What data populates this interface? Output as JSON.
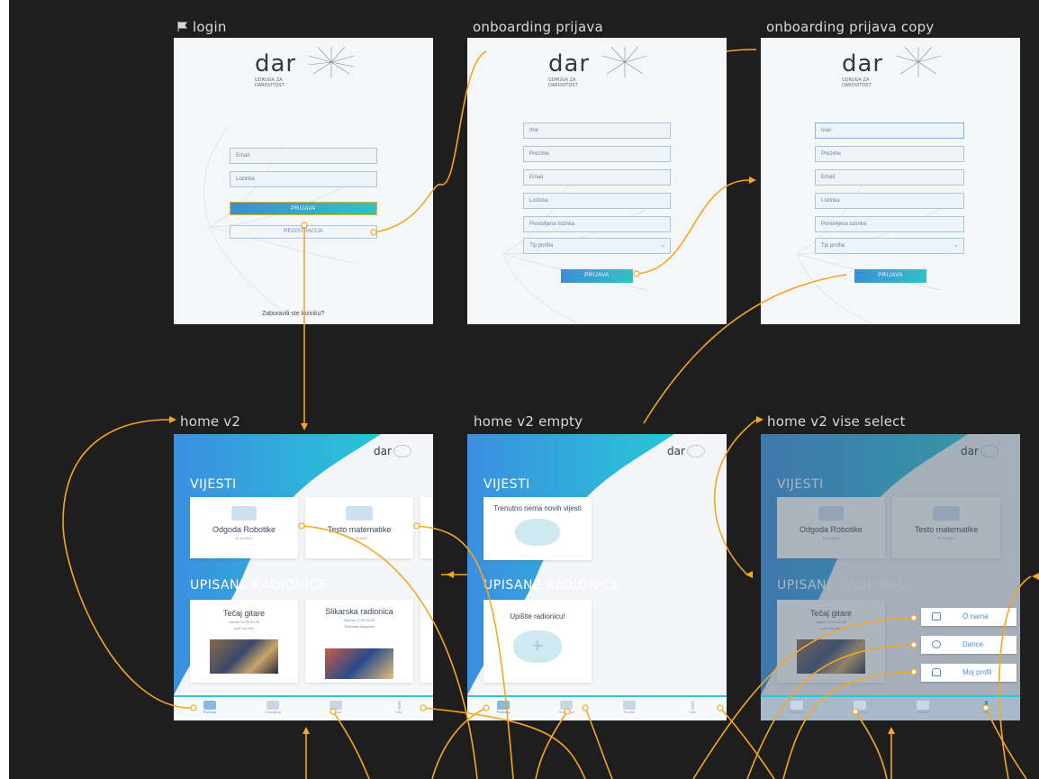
{
  "artboards": {
    "login": "login",
    "onboarding": "onboarding prijava",
    "onboarding_copy": "onboarding prijava copy",
    "home": "home v2",
    "home_empty": "home v2 empty",
    "home_vise": "home v2 vise select"
  },
  "logo": {
    "word": "dar",
    "sub1": "UDRUGA ZA",
    "sub2": "DAROVITOST"
  },
  "login": {
    "email": "Email",
    "password": "Lozinka",
    "prijava": "PRIJAVA",
    "registracija": "REGISTRACIJA",
    "forgot": "Zaboravili ste lozinku?"
  },
  "onboarding": {
    "fields": [
      "Ime",
      "Prezime",
      "Email",
      "Lozinka",
      "Ponovljena lozinka",
      "Tip profila"
    ],
    "prijava": "PRIJAVA"
  },
  "onboarding_copy": {
    "fields": [
      "Ivan",
      "Prezime",
      "Email",
      "Lozinka",
      "Ponovljena lozinka",
      "Tip profila"
    ],
    "prijava": "PRIJAVA"
  },
  "home": {
    "vijesti": "VIJESTI",
    "upisane": "UPISANE RADIONICE",
    "news": [
      {
        "title": "Odgoda Robotike",
        "date": "11.10.2017"
      },
      {
        "title": "Testo matematike",
        "date": "11.10.2017"
      }
    ],
    "workshops": [
      {
        "title": "Tečaj gitare",
        "time": "Utorak 19:00-20:30",
        "place": "prof. Ivo Ivić"
      },
      {
        "title": "Slikarska radionica",
        "time": "Srijeda 17:00-18:30",
        "place": "Richarda Wagnera"
      }
    ],
    "nav": [
      "Početna",
      "Obavijesti",
      "Poruke",
      "Više"
    ]
  },
  "home_empty": {
    "vijesti": "VIJESTI",
    "empty_news": "Trenutno nema novih vijesti",
    "upisane": "UPISANE RADIONICE",
    "empty_workshop": "Upišite radionicu!"
  },
  "home_vise": {
    "vijesti": "VIJESTI",
    "upisane": "UPISANE RADIONICE",
    "menu": [
      "O nama",
      "Dance",
      "Moj profil"
    ]
  },
  "colors": {
    "wire": "#f5a623",
    "accent": "#3a8ed8",
    "teal": "#2fc3c7",
    "canvas": "#1e1e1e"
  }
}
